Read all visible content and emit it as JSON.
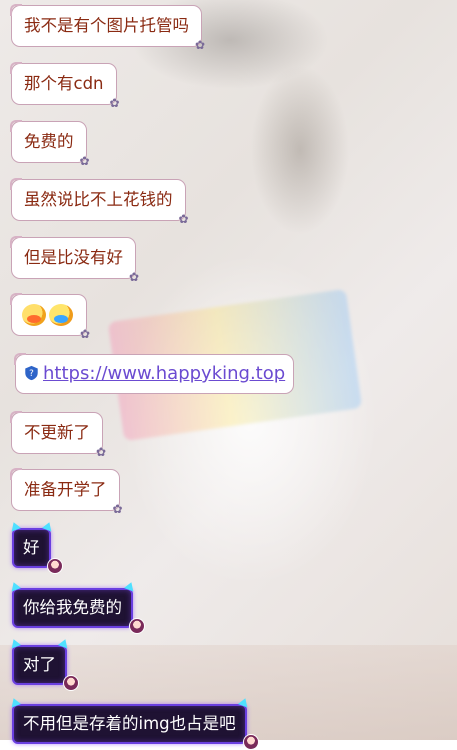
{
  "messages_light": [
    {
      "text": "我不是有个图片托管吗"
    },
    {
      "text": "那个有cdn"
    },
    {
      "text": "免费的"
    },
    {
      "text": "虽然说比不上花钱的"
    },
    {
      "text": "但是比没有好"
    },
    {
      "text": "",
      "emoji": [
        "scared-face-emoji",
        "cold-sweat-face-emoji"
      ]
    },
    {
      "text": "https://www.happyking.top",
      "is_link": true
    },
    {
      "text": "不更新了"
    },
    {
      "text": "准备开学了"
    }
  ],
  "messages_dark": [
    {
      "text": "好"
    },
    {
      "text": "你给我免费的"
    },
    {
      "text": "对了"
    },
    {
      "text": "不用但是存着的img也占是吧"
    }
  ]
}
